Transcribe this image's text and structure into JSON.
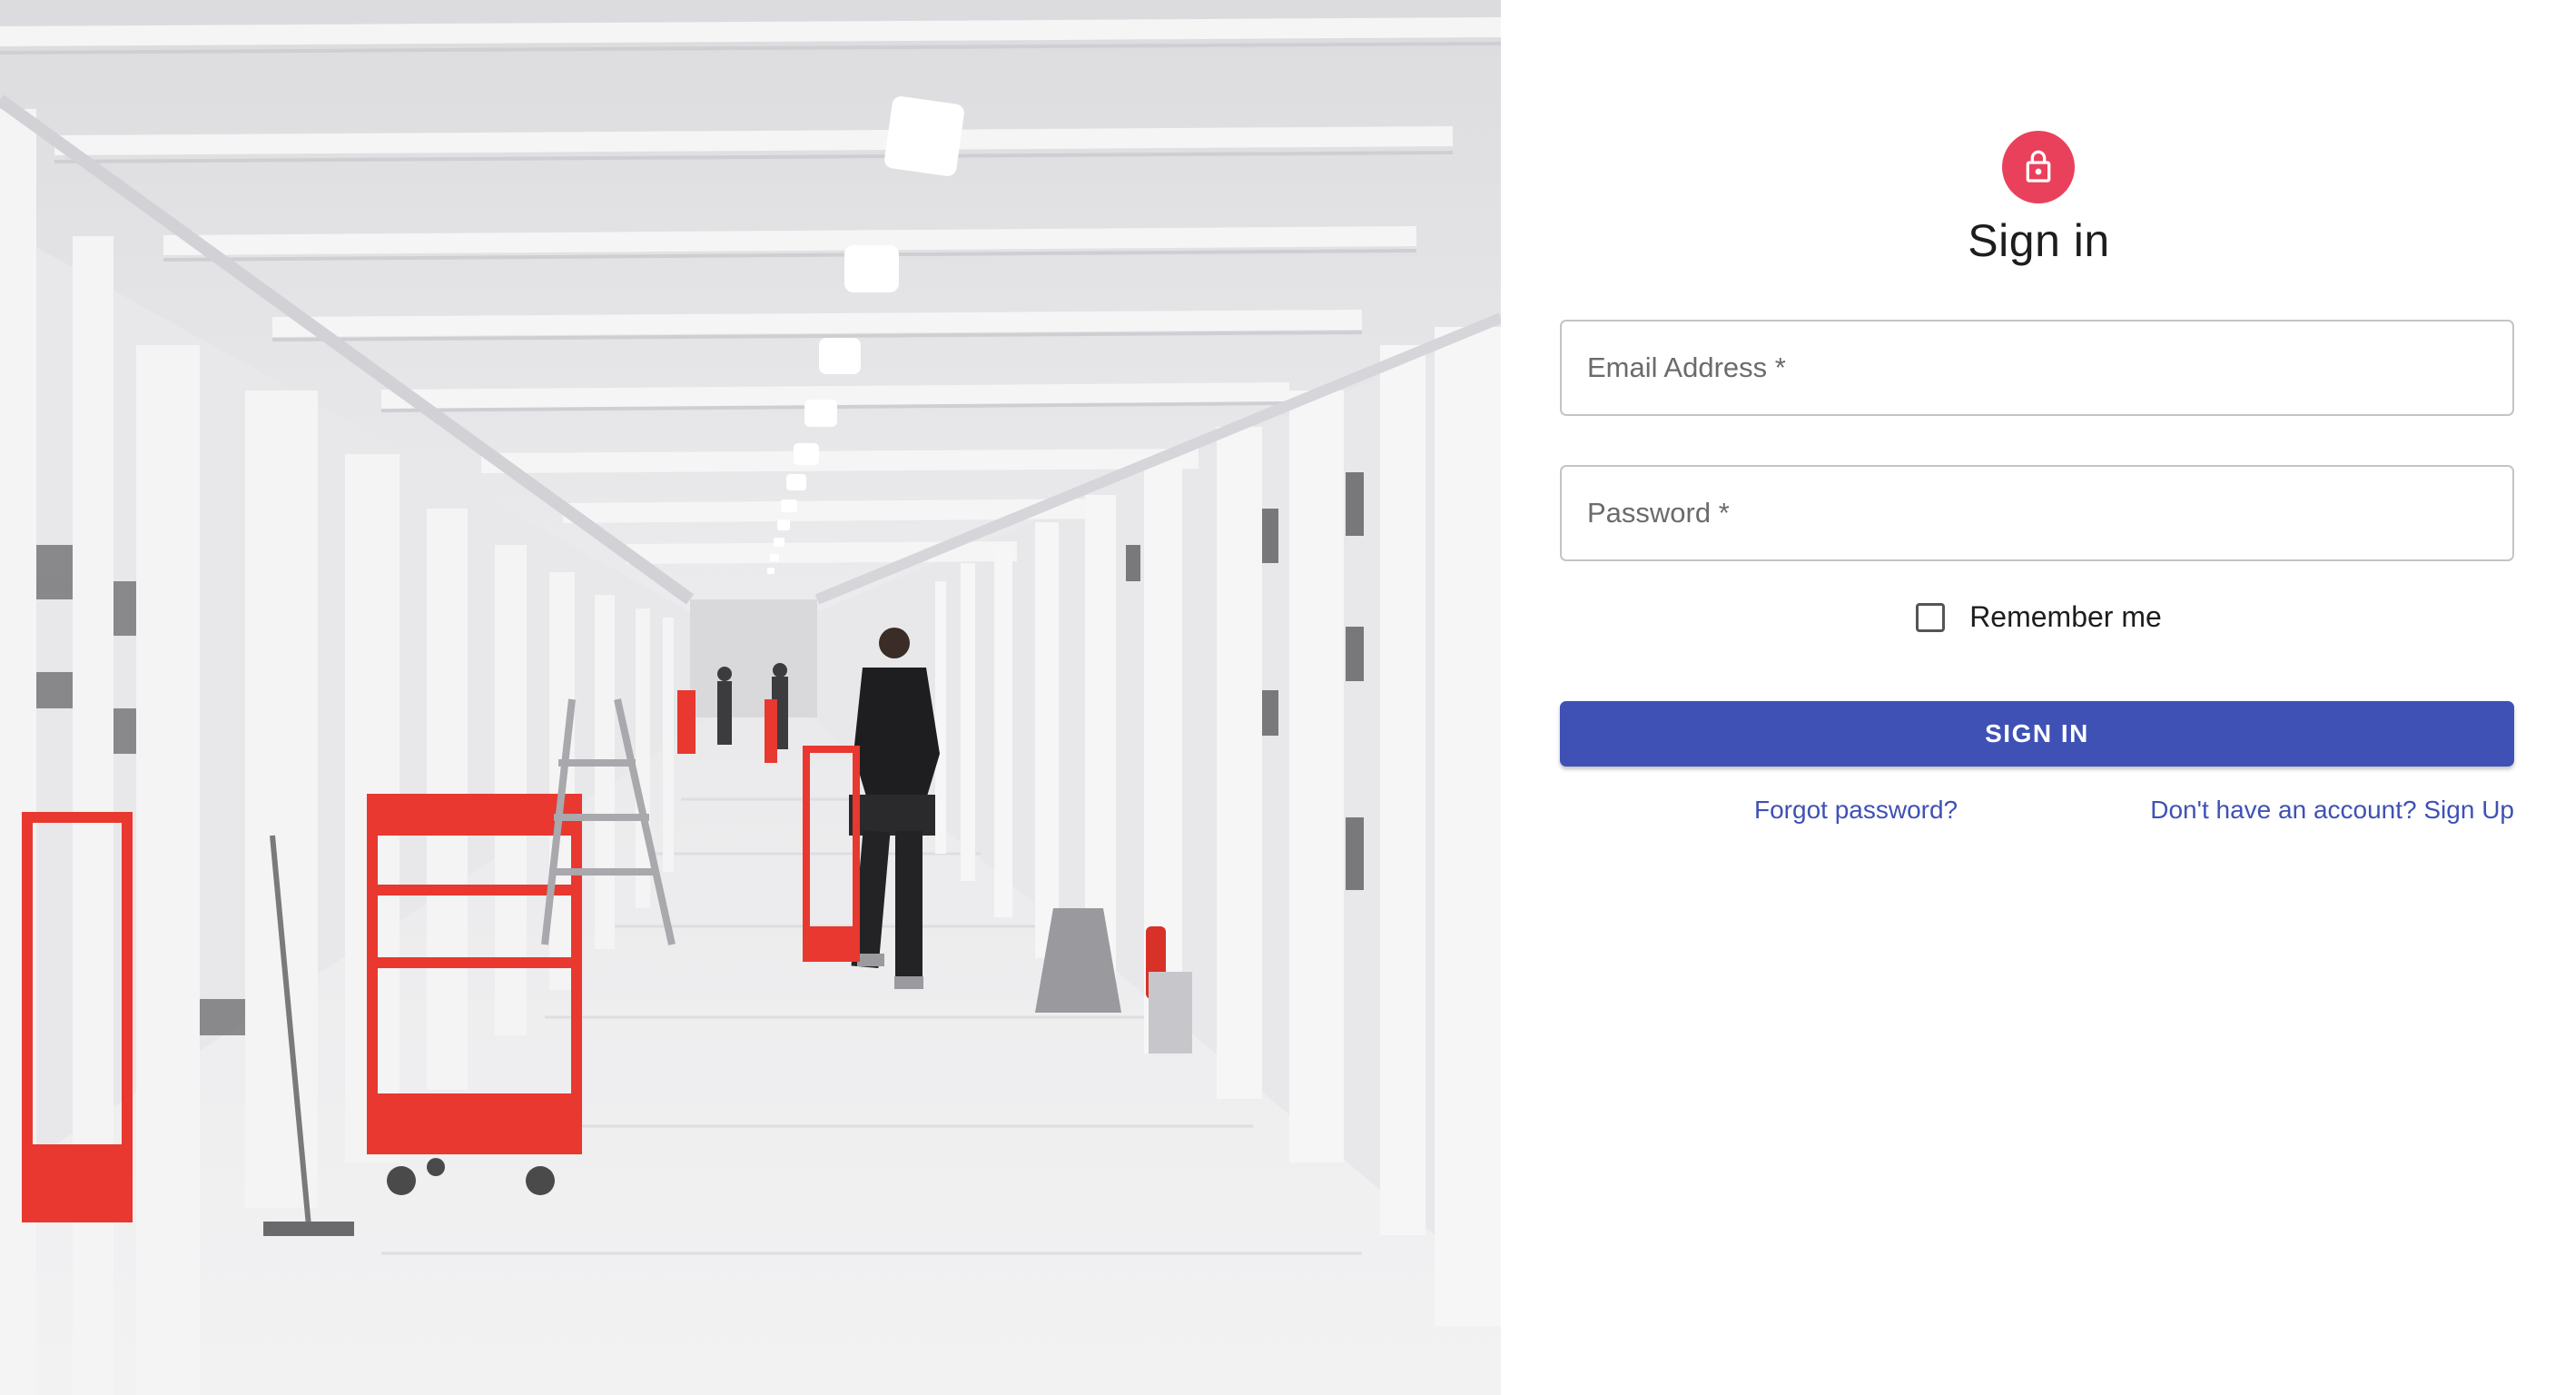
{
  "theme": {
    "primary": "#3f51b5",
    "avatar": "#e9405b",
    "cart_red": "#e8382f"
  },
  "hero": {
    "icon": "warehouse-photo"
  },
  "signin": {
    "avatar_icon": "lock-icon",
    "title": "Sign in",
    "email_placeholder": "Email Address *",
    "password_placeholder": "Password *",
    "remember_label": "Remember me",
    "remember_checked": false,
    "submit_label": "SIGN IN",
    "forgot_link": "Forgot password?",
    "signup_link": "Don't have an account? Sign Up"
  }
}
